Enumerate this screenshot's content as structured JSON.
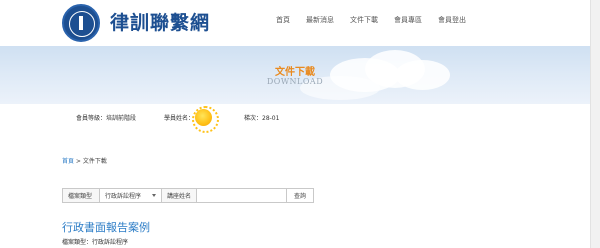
{
  "header": {
    "logo_text": "律訓聯繫網",
    "nav": [
      "首頁",
      "最新消息",
      "文件下載",
      "會員專區",
      "會員登出"
    ]
  },
  "banner": {
    "title": "文件下載",
    "subtitle": "DOWNLOAD"
  },
  "info": {
    "member_level": "會員等級：培訓前階段",
    "student_name_label": "學員姓名：",
    "term": "梯次：28-01"
  },
  "breadcrumb": {
    "home": "首頁",
    "separator": " > ",
    "current": "文件下載"
  },
  "search": {
    "category_label": "檔案類型",
    "category_selected": "行政訴訟程序",
    "name_label": "講座姓名",
    "name_value": "",
    "button": "查詢"
  },
  "content": {
    "section_title": "行政書面報告案例",
    "category_line": "檔案類型：行政訴訟程序"
  },
  "colors": {
    "brand_blue": "#1d4f91",
    "link_blue": "#2b7cc6",
    "banner_orange": "#e98a1f"
  }
}
